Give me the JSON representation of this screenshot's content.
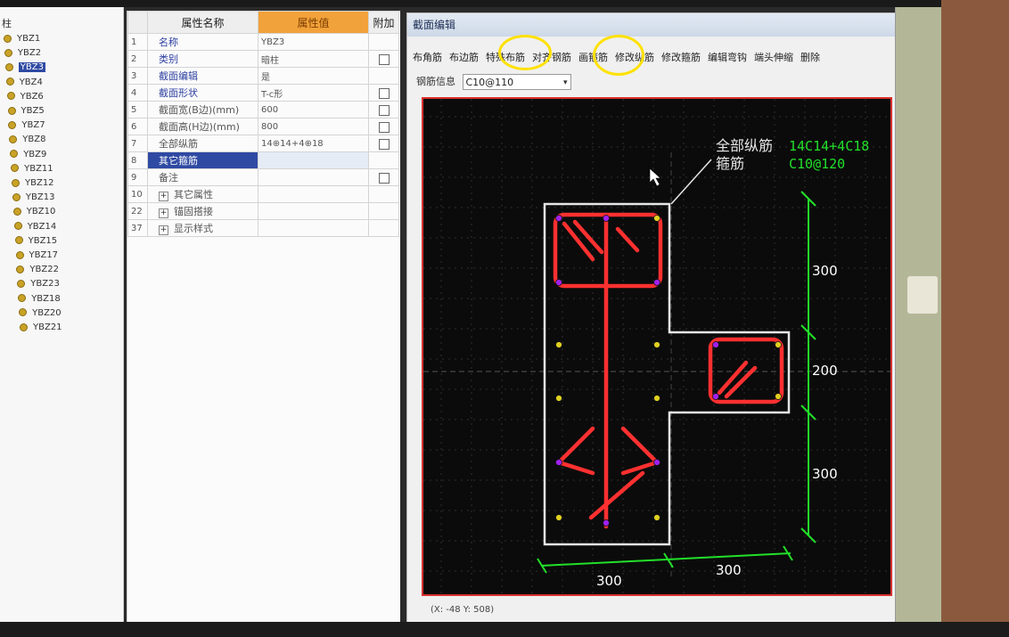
{
  "tree": {
    "root_label": "柱",
    "items": [
      "YBZ1",
      "YBZ2",
      "YBZ3",
      "YBZ4",
      "YBZ6",
      "YBZ5",
      "YBZ7",
      "YBZ8",
      "YBZ9",
      "YBZ11",
      "YBZ12",
      "YBZ13",
      "YBZ10",
      "YBZ14",
      "YBZ15",
      "YBZ17",
      "YBZ22",
      "YBZ23",
      "YBZ18",
      "YBZ20",
      "YBZ21"
    ],
    "selected_index": 2
  },
  "props": {
    "header_name": "属性名称",
    "header_value": "属性值",
    "header_add": "附加",
    "rows": [
      {
        "num": "1",
        "name": "名称",
        "value": "YBZ3",
        "checkbox": false
      },
      {
        "num": "2",
        "name": "类别",
        "value": "暗柱",
        "checkbox": true
      },
      {
        "num": "3",
        "name": "截面编辑",
        "value": "是",
        "checkbox": false
      },
      {
        "num": "4",
        "name": "截面形状",
        "value": "T-c形",
        "checkbox": true
      },
      {
        "num": "5",
        "name": "截面宽(B边)(mm)",
        "value": "600",
        "checkbox": true
      },
      {
        "num": "6",
        "name": "截面高(H边)(mm)",
        "value": "800",
        "checkbox": true
      },
      {
        "num": "7",
        "name": "全部纵筋",
        "value": "14⊕14+4⊕18",
        "checkbox": true
      },
      {
        "num": "8",
        "name": "其它箍筋",
        "value": "",
        "checkbox": false
      },
      {
        "num": "9",
        "name": "备注",
        "value": "",
        "checkbox": true
      },
      {
        "num": "10",
        "name": "其它属性",
        "value": "",
        "checkbox": false
      },
      {
        "num": "22",
        "name": "锚固搭接",
        "value": "",
        "checkbox": false
      },
      {
        "num": "37",
        "name": "显示样式",
        "value": "",
        "checkbox": false
      }
    ]
  },
  "editor": {
    "title": "截面编辑",
    "toolbar": [
      "布角筋",
      "布边筋",
      "特殊布筋",
      "对齐钢筋",
      "画箍筋",
      "修改纵筋",
      "修改箍筋",
      "编辑弯钩",
      "端头伸缩",
      "删除"
    ],
    "rebar_info_label": "钢筋信息",
    "rebar_info_value": "C10@110",
    "status": "(X: -48 Y: 508)"
  },
  "drawing": {
    "label_longitudinal": "全部纵筋",
    "label_stirrup": "箍筋",
    "value_longitudinal": "14C14+4C18",
    "value_stirrup": "C10@120",
    "dim_right_top": "300",
    "dim_right_mid": "200",
    "dim_right_bottom": "300",
    "dim_bottom_left": "300",
    "dim_bottom_right": "300"
  },
  "colors": {
    "rebar": "#ff3030",
    "dimension": "#22e02a",
    "outline": "#e6e6e6",
    "highlight": "#ffe100",
    "value_property_header": "#f2a23a"
  }
}
